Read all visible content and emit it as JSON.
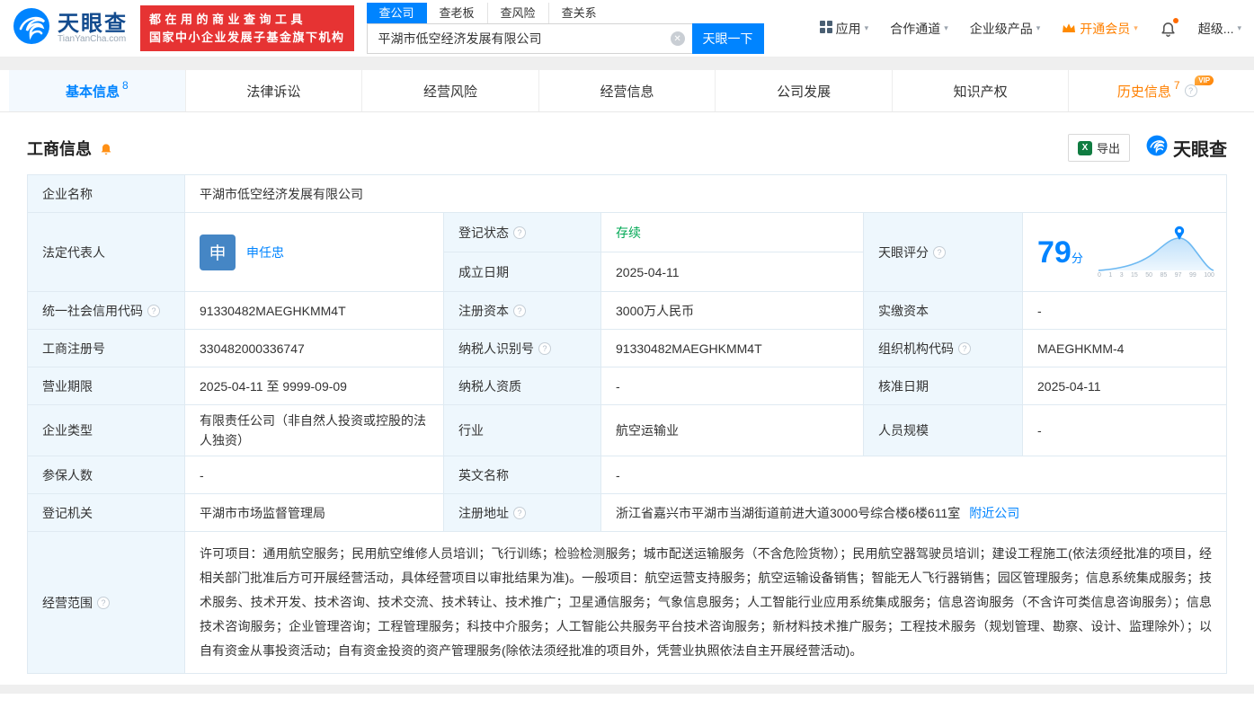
{
  "icons": {
    "caret": "▾",
    "clear": "✕",
    "question": "?"
  },
  "header": {
    "logo": {
      "name": "天眼查",
      "domain": "TianYanCha.com"
    },
    "promo": {
      "line1": "都在用的商业查询工具",
      "line2": "国家中小企业发展子基金旗下机构"
    },
    "search_tabs": [
      {
        "label": "查公司"
      },
      {
        "label": "查老板"
      },
      {
        "label": "查风险"
      },
      {
        "label": "查关系"
      }
    ],
    "search": {
      "value": "平湖市低空经济发展有限公司",
      "button": "天眼一下"
    },
    "nav": {
      "apps": "应用",
      "cooperation": "合作通道",
      "enterprise": "企业级产品",
      "vip": "开通会员",
      "super": "超级..."
    }
  },
  "tabs": {
    "basic": {
      "label": "基本信息",
      "count": "8"
    },
    "legal": {
      "label": "法律诉讼"
    },
    "risk": {
      "label": "经营风险"
    },
    "operation": {
      "label": "经营信息"
    },
    "development": {
      "label": "公司发展"
    },
    "ip": {
      "label": "知识产权"
    },
    "history": {
      "label": "历史信息",
      "count": "7",
      "badge": "VIP"
    }
  },
  "section": {
    "title": "工商信息",
    "export": "导出",
    "brand": "天眼查"
  },
  "info": {
    "name": {
      "label": "企业名称",
      "value": "平湖市低空经济发展有限公司"
    },
    "legal_rep": {
      "label": "法定代表人",
      "avatar": "申",
      "value": "申任忠"
    },
    "status": {
      "label": "登记状态",
      "value": "存续"
    },
    "established": {
      "label": "成立日期",
      "value": "2025-04-11"
    },
    "score": {
      "label": "天眼评分",
      "value": "79",
      "unit": "分",
      "axis": [
        "0",
        "1",
        "3",
        "15",
        "50",
        "85",
        "97",
        "99",
        "100"
      ]
    },
    "credit_code": {
      "label": "统一社会信用代码",
      "value": "91330482MAEGHKMM4T"
    },
    "reg_capital": {
      "label": "注册资本",
      "value": "3000万人民币"
    },
    "paid_capital": {
      "label": "实缴资本",
      "value": "-"
    },
    "reg_no": {
      "label": "工商注册号",
      "value": "330482000336747"
    },
    "taxpayer_no": {
      "label": "纳税人识别号",
      "value": "91330482MAEGHKMM4T"
    },
    "org_code": {
      "label": "组织机构代码",
      "value": "MAEGHKMM-4"
    },
    "term": {
      "label": "营业期限",
      "value": "2025-04-11 至 9999-09-09"
    },
    "taxpayer_quality": {
      "label": "纳税人资质",
      "value": "-"
    },
    "approval_date": {
      "label": "核准日期",
      "value": "2025-04-11"
    },
    "type": {
      "label": "企业类型",
      "value": "有限责任公司（非自然人投资或控股的法人独资）"
    },
    "industry": {
      "label": "行业",
      "value": "航空运输业"
    },
    "staff": {
      "label": "人员规模",
      "value": "-"
    },
    "insured": {
      "label": "参保人数",
      "value": "-"
    },
    "english_name": {
      "label": "英文名称",
      "value": "-"
    },
    "authority": {
      "label": "登记机关",
      "value": "平湖市市场监督管理局"
    },
    "address": {
      "label": "注册地址",
      "value": "浙江省嘉兴市平湖市当湖街道前进大道3000号综合楼6楼611室",
      "link": "附近公司"
    },
    "scope": {
      "label": "经营范围",
      "value": "许可项目：通用航空服务；民用航空维修人员培训；飞行训练；检验检测服务；城市配送运输服务（不含危险货物）；民用航空器驾驶员培训；建设工程施工(依法须经批准的项目，经相关部门批准后方可开展经营活动，具体经营项目以审批结果为准)。一般项目：航空运营支持服务；航空运输设备销售；智能无人飞行器销售；园区管理服务；信息系统集成服务；技术服务、技术开发、技术咨询、技术交流、技术转让、技术推广；卫星通信服务；气象信息服务；人工智能行业应用系统集成服务；信息咨询服务（不含许可类信息咨询服务）；信息技术咨询服务；企业管理咨询；工程管理服务；科技中介服务；人工智能公共服务平台技术咨询服务；新材料技术推广服务；工程技术服务（规划管理、勘察、设计、监理除外）；以自有资金从事投资活动；自有资金投资的资产管理服务(除依法须经批准的项目外，凭营业执照依法自主开展经营活动)。"
    }
  }
}
